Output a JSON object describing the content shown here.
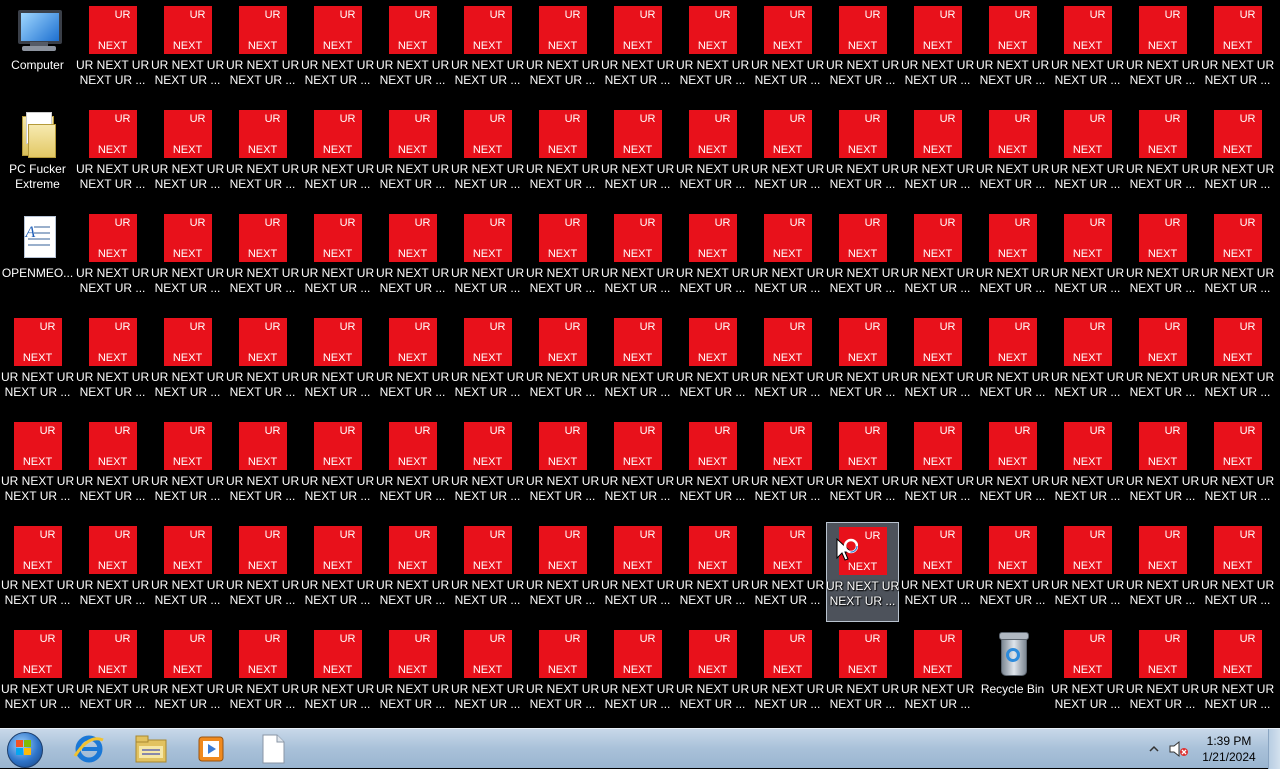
{
  "desktop": {
    "specials": {
      "computer": {
        "label": [
          "Computer"
        ]
      },
      "pc_fucker": {
        "label": [
          "PC Fucker",
          "Extreme"
        ]
      },
      "openmeo": {
        "label": [
          "OPENMEO..."
        ]
      },
      "recycle_bin": {
        "label": [
          "Recycle Bin"
        ]
      }
    },
    "ur_icon": {
      "image_top": "UR",
      "image_bottom": "NEXT",
      "label": [
        "UR NEXT UR",
        "NEXT UR ..."
      ],
      "color": "#e8111b"
    },
    "layout": {
      "columns": 17,
      "rows": 7,
      "special_slots": [
        {
          "col": 0,
          "row": 0,
          "kind": "computer"
        },
        {
          "col": 0,
          "row": 1,
          "kind": "pc_fucker"
        },
        {
          "col": 0,
          "row": 2,
          "kind": "openmeo"
        },
        {
          "col": 13,
          "row": 6,
          "kind": "recycle_bin"
        }
      ],
      "selected": {
        "col": 11,
        "row": 5
      }
    }
  },
  "taskbar": {
    "pinned": [
      "internet-explorer-icon",
      "windows-explorer-icon",
      "media-player-icon",
      "blank-document-icon"
    ],
    "tray": {
      "icons": [
        "show-hidden-icons-arrow",
        "volume-muted-icon"
      ]
    },
    "clock": {
      "time": "1:39 PM",
      "date": "1/21/2024"
    }
  }
}
